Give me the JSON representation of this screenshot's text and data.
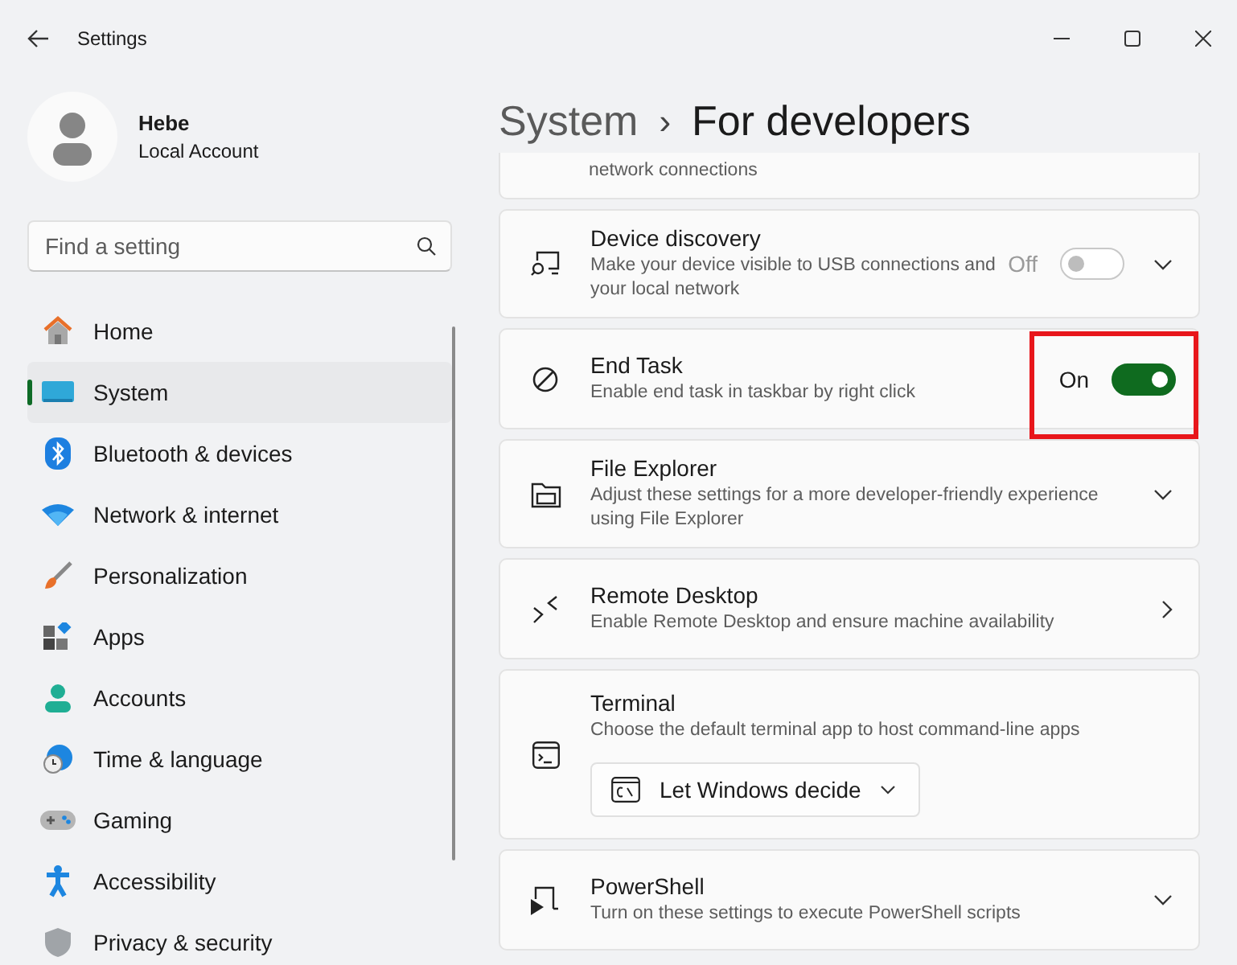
{
  "window": {
    "title": "Settings"
  },
  "user": {
    "name": "Hebe",
    "account": "Local Account"
  },
  "search": {
    "placeholder": "Find a setting"
  },
  "nav": [
    {
      "label": "Home",
      "selected": false
    },
    {
      "label": "System",
      "selected": true
    },
    {
      "label": "Bluetooth & devices",
      "selected": false
    },
    {
      "label": "Network & internet",
      "selected": false
    },
    {
      "label": "Personalization",
      "selected": false
    },
    {
      "label": "Apps",
      "selected": false
    },
    {
      "label": "Accounts",
      "selected": false
    },
    {
      "label": "Time & language",
      "selected": false
    },
    {
      "label": "Gaming",
      "selected": false
    },
    {
      "label": "Accessibility",
      "selected": false
    },
    {
      "label": "Privacy & security",
      "selected": false
    }
  ],
  "breadcrumb": {
    "parent": "System",
    "separator": "›",
    "current": "For developers"
  },
  "settings": [
    {
      "kind": "partial",
      "description": "network connections"
    },
    {
      "kind": "toggle",
      "title": "Device discovery",
      "description": "Make your device visible to USB connections and your local network",
      "state_label": "Off",
      "on": false,
      "disabled": true,
      "expandable": true,
      "highlighted": false
    },
    {
      "kind": "toggle",
      "title": "End Task",
      "description": "Enable end task in taskbar by right click",
      "state_label": "On",
      "on": true,
      "disabled": false,
      "expandable": false,
      "highlighted": true
    },
    {
      "kind": "expand",
      "title": "File Explorer",
      "description": "Adjust these settings for a more developer-friendly experience using File Explorer"
    },
    {
      "kind": "link",
      "title": "Remote Desktop",
      "description": "Enable Remote Desktop and ensure machine availability"
    },
    {
      "kind": "dropdown",
      "title": "Terminal",
      "description": "Choose the default terminal app to host command-line apps",
      "value": "Let Windows decide"
    },
    {
      "kind": "expand",
      "title": "PowerShell",
      "description": "Turn on these settings to execute PowerShell scripts"
    }
  ]
}
